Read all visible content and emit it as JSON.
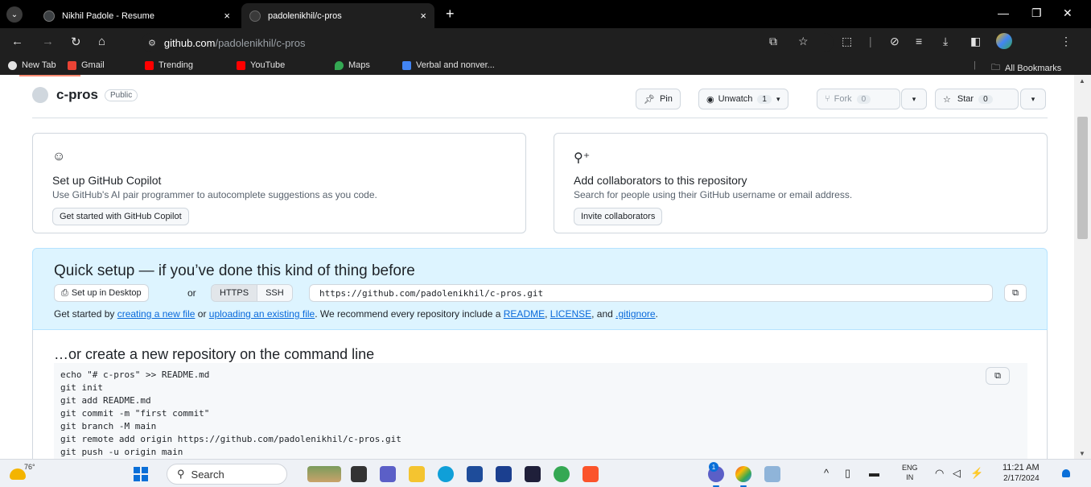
{
  "browser": {
    "tabs": [
      {
        "title": "Nikhil Padole - Resume",
        "close": "×",
        "active": false
      },
      {
        "title": "padolenikhil/c-pros",
        "close": "×",
        "active": true
      }
    ],
    "new_tab": "+",
    "window_controls": {
      "minimize": "—",
      "restore": "❐",
      "close": "✕"
    },
    "address": {
      "host": "github.com",
      "path": "/padolenikhil/c-pros"
    },
    "bookmarks": [
      {
        "label": "New Tab",
        "color": "#e3e3e3"
      },
      {
        "label": "Gmail",
        "color": "#ea4335"
      },
      {
        "label": "Trending",
        "color": "#ff0000"
      },
      {
        "label": "YouTube",
        "color": "#ff0000"
      },
      {
        "label": "Maps",
        "color": "#34a853"
      },
      {
        "label": "Verbal and nonver...",
        "color": "#4285f4"
      }
    ],
    "all_bookmarks": "All Bookmarks"
  },
  "repo": {
    "name": "c-pros",
    "visibility": "Public",
    "pin_label": "Pin",
    "unwatch_label": "Unwatch",
    "unwatch_count": "1",
    "fork_label": "Fork",
    "fork_count": "0",
    "star_label": "Star",
    "star_count": "0"
  },
  "cards": {
    "copilot": {
      "title": "Set up GitHub Copilot",
      "desc": "Use GitHub's AI pair programmer to autocomplete suggestions as you code.",
      "button": "Get started with GitHub Copilot"
    },
    "collab": {
      "title": "Add collaborators to this repository",
      "desc": "Search for people using their GitHub username or email address.",
      "button": "Invite collaborators"
    }
  },
  "quick_setup": {
    "title": "Quick setup — if you’ve done this kind of thing before",
    "desktop_button": "Set up in Desktop",
    "or": "or",
    "https": "HTTPS",
    "ssh": "SSH",
    "url": "https://github.com/padolenikhil/c-pros.git",
    "help": {
      "p1": "Get started by ",
      "link1": "creating a new file",
      "p2": " or ",
      "link2": "uploading an existing file",
      "p3": ". We recommend every repository include a ",
      "link3": "README",
      "p4": ", ",
      "link4": "LICENSE",
      "p5": ", and ",
      "link5": ".gitignore",
      "p6": "."
    }
  },
  "command_line": {
    "title": "…or create a new repository on the command line",
    "lines": [
      "echo \"# c-pros\" >> README.md",
      "git init",
      "git add README.md",
      "git commit -m \"first commit\"",
      "git branch -M main",
      "git remote add origin https://github.com/padolenikhil/c-pros.git",
      "git push -u origin main"
    ]
  },
  "taskbar": {
    "weather_temp": "76°",
    "search_placeholder": "Search",
    "notification_count": "1",
    "lang_top": "ENG",
    "lang_bottom": "IN",
    "time": "11:21 AM",
    "date": "2/17/2024"
  }
}
